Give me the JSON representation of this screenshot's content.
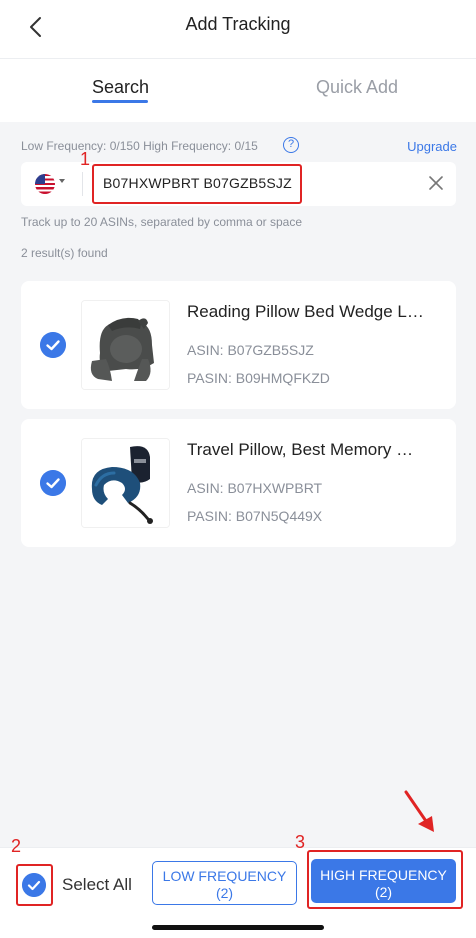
{
  "header": {
    "title": "Add Tracking",
    "back_icon": "chevron-left-icon"
  },
  "tabs": [
    {
      "label": "Search",
      "active": true
    },
    {
      "label": "Quick Add",
      "active": false
    }
  ],
  "frequency": {
    "text": "Low Frequency: 0/150 High Frequency: 0/15",
    "help_icon": "?",
    "upgrade": "Upgrade"
  },
  "search": {
    "value": "B07HXWPBRT B07GZB5SJZ",
    "country_icon": "us-flag-icon",
    "clear_icon": "close-icon"
  },
  "hint": "Track up to 20 ASINs, separated by comma or space",
  "results_text": "2 result(s) found",
  "products": [
    {
      "title": "Reading Pillow Bed Wedge L…",
      "asin": "ASIN: B07GZB5SJZ",
      "pasin": "PASIN: B09HMQFKZD",
      "checked": true
    },
    {
      "title": "Travel Pillow, Best Memory …",
      "asin": "ASIN: B07HXWPBRT",
      "pasin": "PASIN: B07N5Q449X",
      "checked": true
    }
  ],
  "bottom": {
    "select_all": "Select All",
    "low_button_line1": "LOW FREQUENCY",
    "low_button_line2": "(2)",
    "high_button_line1": "HIGH FREQUENCY",
    "high_button_line2": "(2)"
  },
  "annotations": {
    "n1": "1",
    "n2": "2",
    "n3": "3",
    "color": "#e02424"
  },
  "colors": {
    "accent": "#3b78e7",
    "annotation": "#e02424"
  }
}
